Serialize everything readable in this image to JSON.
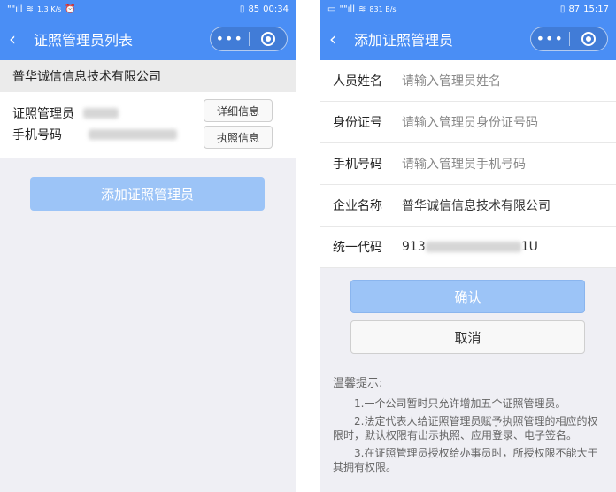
{
  "left": {
    "status": {
      "signal": "\"\"ıll",
      "speed": "1.3 K/s",
      "battery": "85",
      "time": "00:34"
    },
    "nav": {
      "title": "证照管理员列表",
      "more": "•••"
    },
    "company": "普华诚信信息技术有限公司",
    "card": {
      "admin_label": "证照管理员",
      "phone_label": "手机号码",
      "detail_btn": "详细信息",
      "license_btn": "执照信息"
    },
    "add_button": "添加证照管理员"
  },
  "right": {
    "status": {
      "signal": "\"\"ıll",
      "speed": "831 B/s",
      "battery": "87",
      "time": "15:17"
    },
    "nav": {
      "title": "添加证照管理员",
      "more": "•••"
    },
    "fields": [
      {
        "label": "人员姓名",
        "value": "请输入管理员姓名",
        "filled": false
      },
      {
        "label": "身份证号",
        "value": "请输入管理员身份证号码",
        "filled": false
      },
      {
        "label": "手机号码",
        "value": "请输入管理员手机号码",
        "filled": false
      },
      {
        "label": "企业名称",
        "value": "普华诚信信息技术有限公司",
        "filled": true
      },
      {
        "label": "统一代码",
        "value_prefix": "913",
        "value_suffix": "1U",
        "filled": true
      }
    ],
    "confirm": "确认",
    "cancel": "取消",
    "tips": {
      "title": "温馨提示:",
      "items": [
        "1.一个公司暂时只允许增加五个证照管理员。",
        "2.法定代表人给证照管理员赋予执照管理的相应的权限时，默认权限有出示执照、应用登录、电子签名。",
        "3.在证照管理员授权给办事员时，所授权限不能大于其拥有权限。"
      ]
    }
  },
  "colors": {
    "brand": "#4a8ef5",
    "button_disabled": "#9cc4f7"
  }
}
